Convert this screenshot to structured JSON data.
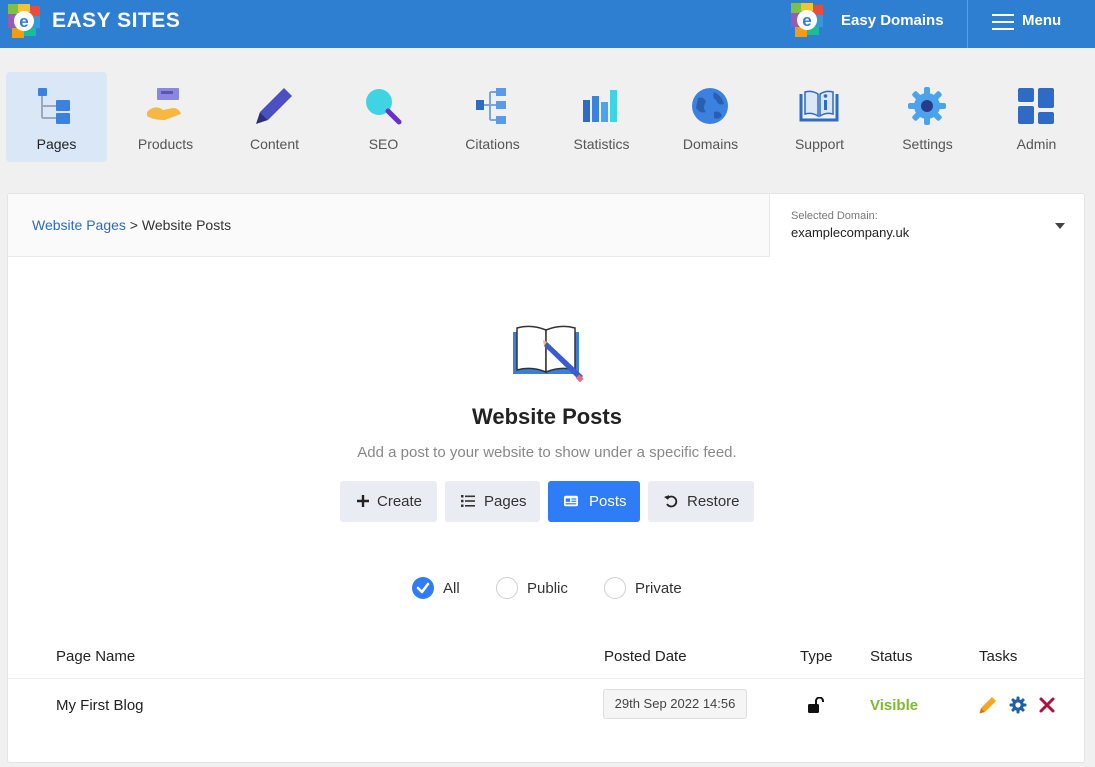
{
  "header": {
    "brand": "EASY SITES",
    "domain_product": "Easy Domains",
    "menu_label": "Menu",
    "accent": "#2e7ed1"
  },
  "nav": {
    "items": [
      {
        "label": "Pages",
        "icon": "pages-icon",
        "active": true
      },
      {
        "label": "Products",
        "icon": "products-icon"
      },
      {
        "label": "Content",
        "icon": "content-icon"
      },
      {
        "label": "SEO",
        "icon": "seo-icon"
      },
      {
        "label": "Citations",
        "icon": "citations-icon"
      },
      {
        "label": "Statistics",
        "icon": "statistics-icon"
      },
      {
        "label": "Domains",
        "icon": "domains-icon"
      },
      {
        "label": "Support",
        "icon": "support-icon"
      },
      {
        "label": "Settings",
        "icon": "settings-icon"
      },
      {
        "label": "Admin",
        "icon": "admin-icon"
      }
    ]
  },
  "breadcrumb": {
    "parent": "Website Pages",
    "separator": ">",
    "current": "Website Posts"
  },
  "domain_selector": {
    "label": "Selected Domain:",
    "value": "examplecompany.uk"
  },
  "page": {
    "title": "Website Posts",
    "subtitle": "Add a post to your website to show under a specific feed."
  },
  "actions": {
    "create": "Create",
    "pages": "Pages",
    "posts": "Posts",
    "restore": "Restore",
    "primary_color": "#2e7cf6"
  },
  "filters": {
    "all": "All",
    "public": "Public",
    "private": "Private",
    "selected": "All"
  },
  "table": {
    "headers": {
      "name": "Page Name",
      "date": "Posted Date",
      "type": "Type",
      "status": "Status",
      "tasks": "Tasks"
    },
    "rows": [
      {
        "name": "My First Blog",
        "date": "29th Sep 2022 14:56",
        "type_icon": "unlocked-icon",
        "status": "Visible",
        "status_color": "#7cba2e"
      }
    ]
  }
}
